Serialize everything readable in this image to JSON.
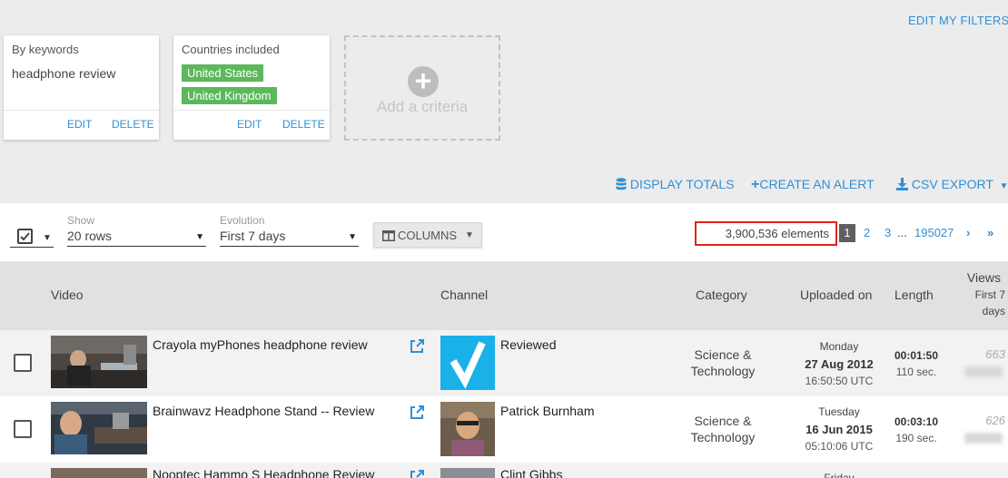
{
  "filters": {
    "edit_label": "EDIT MY FILTERS",
    "cards": [
      {
        "title": "By keywords",
        "value": "headphone review",
        "edit": "EDIT",
        "delete": "DELETE"
      },
      {
        "title": "Countries included",
        "tags": [
          "United States",
          "United Kingdom"
        ],
        "edit": "EDIT",
        "delete": "DELETE"
      }
    ],
    "add_criteria": "Add a criteria"
  },
  "actions": {
    "display_totals": "DISPLAY TOTALS",
    "create_alert": "CREATE AN ALERT",
    "csv_export": "CSV EXPORT"
  },
  "controls": {
    "show_label": "Show",
    "show_value": "20 rows",
    "evolution_label": "Evolution",
    "evolution_value": "First 7 days",
    "columns_label": "COLUMNS",
    "elements_count": "3,900,536 elements",
    "pagination": {
      "current": "1",
      "pages": [
        "2",
        "3"
      ],
      "ellipsis": "...",
      "last": "195027"
    }
  },
  "table": {
    "headers": {
      "video": "Video",
      "channel": "Channel",
      "category": "Category",
      "uploaded": "Uploaded on",
      "length": "Length",
      "views": "Views",
      "views_sub1": "First 7",
      "views_sub2": "days"
    },
    "rows": [
      {
        "title": "Crayola myPhones headphone review",
        "channel": "Reviewed",
        "category_1": "Science &",
        "category_2": "Technology",
        "day": "Monday",
        "date": "27 Aug 2012",
        "time": "16:50:50 UTC",
        "length": "00:01:50",
        "seconds": "110 sec.",
        "views": "663"
      },
      {
        "title": "Brainwavz Headphone Stand -- Review",
        "channel": "Patrick Burnham",
        "category_1": "Science &",
        "category_2": "Technology",
        "day": "Tuesday",
        "date": "16 Jun 2015",
        "time": "05:10:06 UTC",
        "length": "00:03:10",
        "seconds": "190 sec.",
        "views": "626"
      },
      {
        "title": "Nooptec Hammo S Headphone Review",
        "channel": "Clint Gibbs",
        "day": "Friday"
      }
    ]
  },
  "colors": {
    "link": "#2e8fd8",
    "tag": "#5cb85c",
    "highlight": "#e2231a",
    "current_page": "#5f5f5f"
  }
}
